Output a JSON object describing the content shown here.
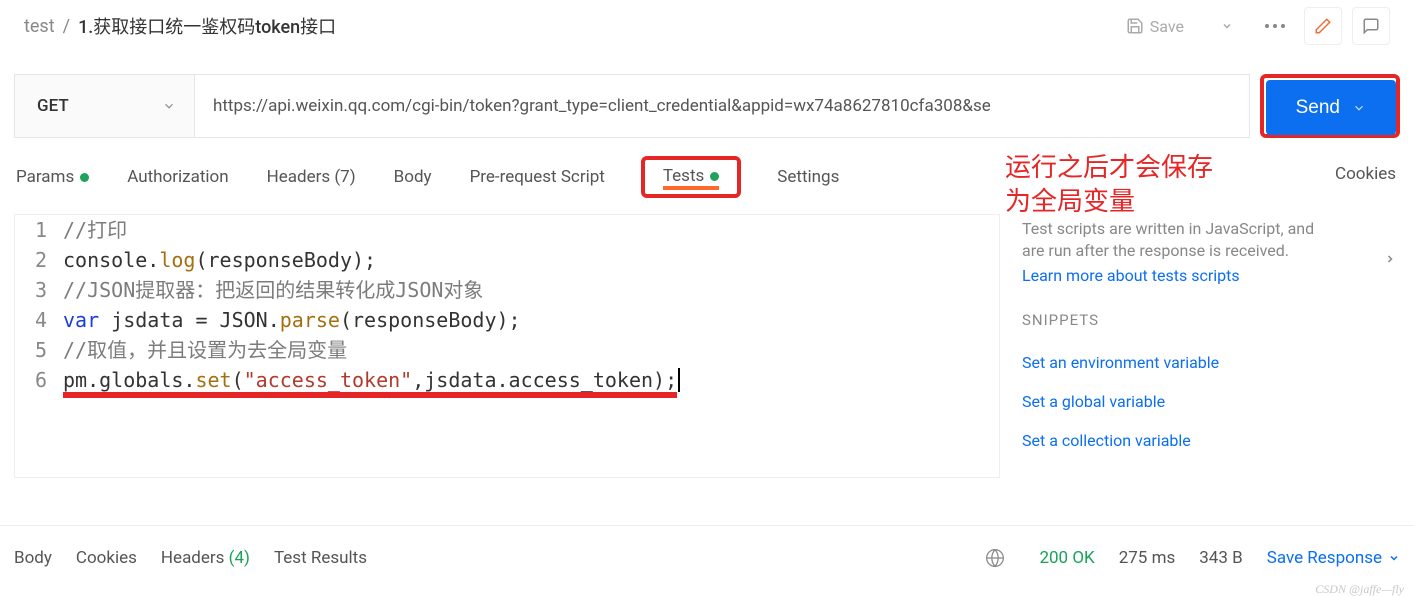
{
  "breadcrumb": {
    "parent": "test",
    "sep": "/",
    "current": "1.获取接口统一鉴权码token接口"
  },
  "top": {
    "save": "Save"
  },
  "request": {
    "method": "GET",
    "url": "https://api.weixin.qq.com/cgi-bin/token?grant_type=client_credential&appid=wx74a8627810cfa308&se",
    "send": "Send"
  },
  "tabs": {
    "params": "Params",
    "authorization": "Authorization",
    "headers": "Headers (7)",
    "body": "Body",
    "prerequest": "Pre-request Script",
    "tests": "Tests",
    "settings": "Settings",
    "cookies": "Cookies"
  },
  "annotation": {
    "line1": "运行之后才会保存",
    "line2": "为全局变量"
  },
  "code": {
    "l1_comment": "//打印",
    "l2_a": "console.",
    "l2_b": "log",
    "l2_c": "(responseBody);",
    "l3_comment": "//JSON提取器：把返回的结果转化成JSON对象",
    "l4_a": "var",
    "l4_b": " jsdata = JSON.",
    "l4_c": "parse",
    "l4_d": "(responseBody);",
    "l5_comment": "//取值，并且设置为去全局变量",
    "l6_a": "pm.globals.",
    "l6_b": "set",
    "l6_c": "(",
    "l6_d": "\"access_token\"",
    "l6_e": ",jsdata.access_token);"
  },
  "side": {
    "desc1": "Test scripts are written in JavaScript, and",
    "desc2": "are run after the response is received.",
    "learn": "Learn more about tests scripts",
    "snippets_h": "SNIPPETS",
    "snip1": "Set an environment variable",
    "snip2": "Set a global variable",
    "snip3": "Set a collection variable"
  },
  "response": {
    "body": "Body",
    "cookies": "Cookies",
    "headers": "Headers",
    "hcount": "(4)",
    "testresults": "Test Results",
    "status": "200 OK",
    "time": "275 ms",
    "size": "343 B",
    "save_resp": "Save Response"
  },
  "watermark": "CSDN @jaffe—fly"
}
